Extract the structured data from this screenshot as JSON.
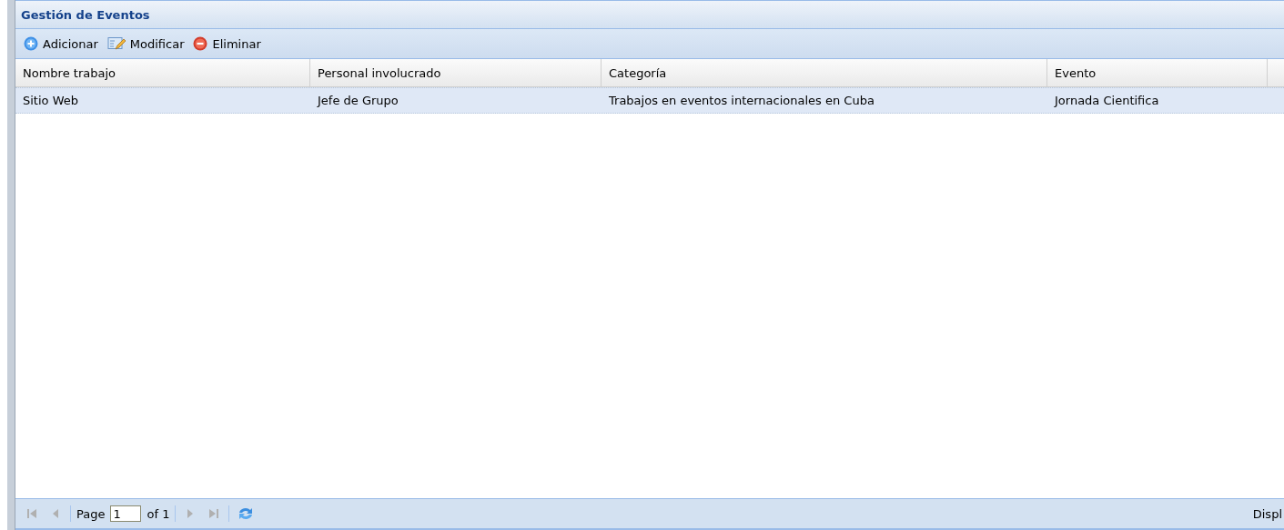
{
  "panel": {
    "title": "Gestión de Eventos"
  },
  "toolbar": [
    {
      "kind": "add",
      "label": "Adicionar"
    },
    {
      "kind": "edit",
      "label": "Modificar"
    },
    {
      "kind": "delete",
      "label": "Eliminar"
    }
  ],
  "table": {
    "columns": [
      "Nombre trabajo",
      "Personal involucrado",
      "Categoría",
      "Evento"
    ],
    "rows": [
      {
        "selected": true,
        "cells": [
          "Sitio Web",
          "Jefe de Grupo",
          "Trabajos en eventos internacionales en Cuba",
          "Jornada Cientifica"
        ]
      }
    ]
  },
  "paging": {
    "first_disabled": true,
    "prev_disabled": true,
    "next_disabled": true,
    "last_disabled": true,
    "page_label": "Page",
    "page": "1",
    "of_label": "of 1",
    "display_text": "Displ"
  }
}
